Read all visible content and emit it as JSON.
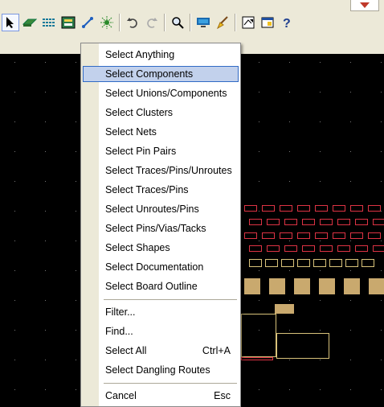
{
  "colors": {
    "toolbar_bg": "#ece9d8",
    "canvas_bg": "#000000",
    "highlight_bg": "#c2d1ec",
    "highlight_border": "#316ac5",
    "pcb_red": "#dd3344",
    "pcb_pad": "#c9a96e"
  },
  "toolbar": {
    "buttons": [
      "select-arrow-icon",
      "place-component-icon",
      "route-icon",
      "board-layers-icon",
      "wire-icon",
      "fanout-icon",
      "undo-icon",
      "redo-icon",
      "zoom-icon",
      "view-icon",
      "clean-icon",
      "report-icon",
      "window-icon",
      "help-icon"
    ]
  },
  "menu": {
    "items": [
      {
        "label": "Select Anything",
        "shortcut": ""
      },
      {
        "label": "Select Components",
        "shortcut": ""
      },
      {
        "label": "Select Unions/Components",
        "shortcut": ""
      },
      {
        "label": "Select Clusters",
        "shortcut": ""
      },
      {
        "label": "Select Nets",
        "shortcut": ""
      },
      {
        "label": "Select Pin Pairs",
        "shortcut": ""
      },
      {
        "label": "Select Traces/Pins/Unroutes",
        "shortcut": ""
      },
      {
        "label": "Select Traces/Pins",
        "shortcut": ""
      },
      {
        "label": "Select Unroutes/Pins",
        "shortcut": ""
      },
      {
        "label": "Select Pins/Vias/Tacks",
        "shortcut": ""
      },
      {
        "label": "Select Shapes",
        "shortcut": ""
      },
      {
        "label": "Select Documentation",
        "shortcut": ""
      },
      {
        "label": "Select Board Outline",
        "shortcut": ""
      },
      {
        "label": "Filter...",
        "shortcut": ""
      },
      {
        "label": "Find...",
        "shortcut": ""
      },
      {
        "label": "Select All",
        "shortcut": "Ctrl+A"
      },
      {
        "label": "Select Dangling Routes",
        "shortcut": ""
      },
      {
        "label": "Cancel",
        "shortcut": "Esc"
      }
    ]
  }
}
